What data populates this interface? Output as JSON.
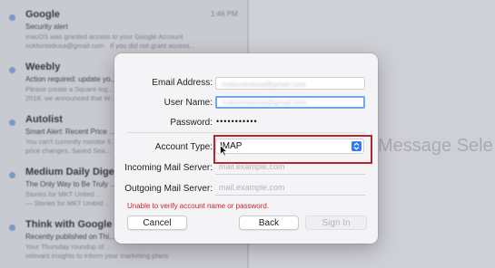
{
  "mail_list": {
    "items": [
      {
        "sender": "Google",
        "time": "1:46 PM",
        "subject": "Security alert",
        "preview": "macOS was granted access to your Google Account\nnoktuntedusa@gmail.com   If you did not grant access..."
      },
      {
        "sender": "Weebly",
        "time": "",
        "subject": "Action required: update yo...",
        "preview": "Please create a Square log...\n2018, we announced that W..."
      },
      {
        "sender": "Autolist",
        "time": "",
        "subject": "Smart Alert: Recent Price ...",
        "preview": "You can't currently monitor li...\nprice changes. Saved Sea..."
      },
      {
        "sender": "Medium Daily Digest",
        "time": "",
        "subject": "The Only Way to Be Truly ...",
        "preview": "Stories for MKT United ...\n— Stories for MKT United ..."
      },
      {
        "sender": "Think with Google US",
        "time": "",
        "subject": "Recently published on Thi...",
        "preview": "Your Thursday roundup of ...\nrelevant insights to inform your marketing plans"
      }
    ]
  },
  "right_pane": {
    "message_select": "Message Sele"
  },
  "dialog": {
    "email_label": "Email Address:",
    "email_value": "noktuntedusa@gmail.com",
    "username_label": "User Name:",
    "username_value": "noktuntedusa@gmail.com",
    "password_label": "Password:",
    "password_value": "•••••••••••",
    "account_type_label": "Account Type:",
    "account_type_value": "IMAP",
    "incoming_label": "Incoming Mail Server:",
    "incoming_placeholder": "mail.example.com",
    "outgoing_label": "Outgoing Mail Server:",
    "outgoing_placeholder": "mail.example.com",
    "error_text": "Unable to verify account name or password.",
    "cancel_label": "Cancel",
    "back_label": "Back",
    "signin_label": "Sign In"
  },
  "colors": {
    "accent": "#2f7cf6",
    "error": "#c8262a",
    "highlight": "#b8262a"
  }
}
